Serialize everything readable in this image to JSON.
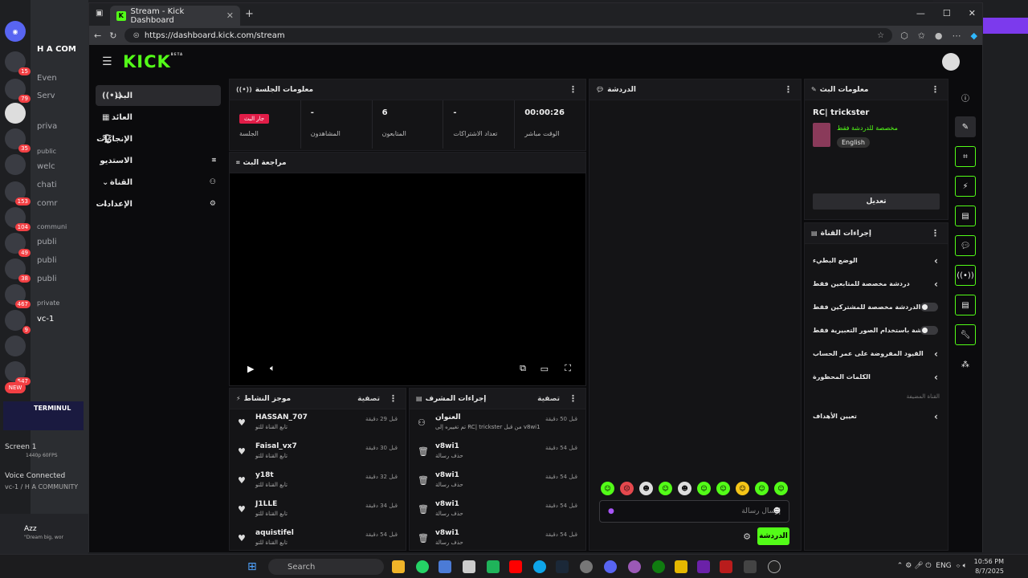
{
  "browser": {
    "tab_title": "Stream - Kick Dashboard",
    "url": "https://dashboard.kick.com/stream"
  },
  "kick": {
    "logo": "KICK",
    "logo_sup": "BETA",
    "nav": [
      {
        "label": "البث",
        "icon": "live-icon"
      },
      {
        "label": "العائد",
        "icon": "revenue-icon"
      },
      {
        "label": "الإنجازات",
        "icon": "trophy-icon"
      },
      {
        "label": "الاستديو",
        "icon": "studio-icon"
      },
      {
        "label": "القناة",
        "icon": "channel-icon"
      },
      {
        "label": "الإعدادات",
        "icon": "settings-icon"
      }
    ],
    "session": {
      "title": "معلومات الجلسة",
      "live_pill": "جار البث",
      "stats": [
        {
          "value": "",
          "label": "الجلسة"
        },
        {
          "value": "-",
          "label": "المشاهدون"
        },
        {
          "value": "6",
          "label": "المتابعون"
        },
        {
          "value": "-",
          "label": "تعداد الاشتراكات"
        },
        {
          "value": "00:00:26",
          "label": "الوقت مباشر"
        }
      ]
    },
    "preview": {
      "title": "مراجعة البث"
    },
    "activity": {
      "title": "موجز النشاط",
      "filter": "تصفية",
      "rows": [
        {
          "name": "HASSAN_707",
          "sub": "تابع القناة للتو",
          "time": "قبل 29 دقيقة"
        },
        {
          "name": "Faisal_vx7",
          "sub": "تابع القناة للتو",
          "time": "قبل 30 دقيقة"
        },
        {
          "name": "y18t",
          "sub": "تابع القناة للتو",
          "time": "قبل 32 دقيقة"
        },
        {
          "name": "J1LLE",
          "sub": "تابع القناة للتو",
          "time": "قبل 34 دقيقة"
        },
        {
          "name": "aquistifel",
          "sub": "تابع القناة للتو",
          "time": "قبل 54 دقيقة"
        }
      ]
    },
    "mod": {
      "title": "إجراءات المشرف",
      "filter": "تصفية",
      "rows": [
        {
          "name": "العنوان",
          "sub": "تم تغييره إلى RC| trickster من قبل v8wi1",
          "time": "قبل 50 دقيقة"
        },
        {
          "name": "v8wi1",
          "sub": "حذف رسالة",
          "time": "قبل 54 دقيقة"
        },
        {
          "name": "v8wi1",
          "sub": "حذف رسالة",
          "time": "قبل 54 دقيقة"
        },
        {
          "name": "v8wi1",
          "sub": "حذف رسالة",
          "time": "قبل 54 دقيقة"
        },
        {
          "name": "v8wi1",
          "sub": "حذف رسالة",
          "time": "قبل 54 دقيقة"
        }
      ]
    },
    "chat": {
      "title": "الدردشة",
      "placeholder": "إرسال رسالة",
      "send": "الدردشة"
    },
    "stream_info": {
      "title": "معلومات البث",
      "stream_title": "RC| trickster",
      "category": "مخصصة للدردشة فقط",
      "language": "English",
      "edit": "تعديل"
    },
    "channel_actions": {
      "title": "إجراءات القناة",
      "rows": [
        {
          "label": "الوضع البطيء",
          "type": "arrow"
        },
        {
          "label": "دردشة مخصصة للمتابعين فقط",
          "type": "arrow"
        },
        {
          "label": "الدردشة مخصصة للمشتركين فقط",
          "type": "toggle"
        },
        {
          "label": "الدردشة باستخدام الصور التعبيرية فقط",
          "type": "toggle"
        },
        {
          "label": "القيود المفروضة على عمر الحساب",
          "type": "arrow"
        },
        {
          "label": "الكلمات المحظورة",
          "type": "arrow"
        }
      ],
      "section": "القناة المضيفة",
      "target": "تعيين الأهداف"
    }
  },
  "taskbar": {
    "search": "Search",
    "lang": "ENG",
    "time": "10:56 PM",
    "date": "8/7/2025"
  },
  "discord": {
    "server": "H A COM",
    "channels": [
      "Even",
      "Serv",
      "priva",
      "public",
      "welc",
      "chati",
      "comr",
      "communi",
      "publi",
      "publi",
      "publi",
      "private",
      "vc-1"
    ],
    "screen": "Screen 1",
    "screen_sub": "1440p 60FPS",
    "voice": "Voice Connected",
    "voice_sub": "vc-1 / H A COMMUNITY",
    "user": "Azz",
    "status": "\"Dream big, wor"
  }
}
